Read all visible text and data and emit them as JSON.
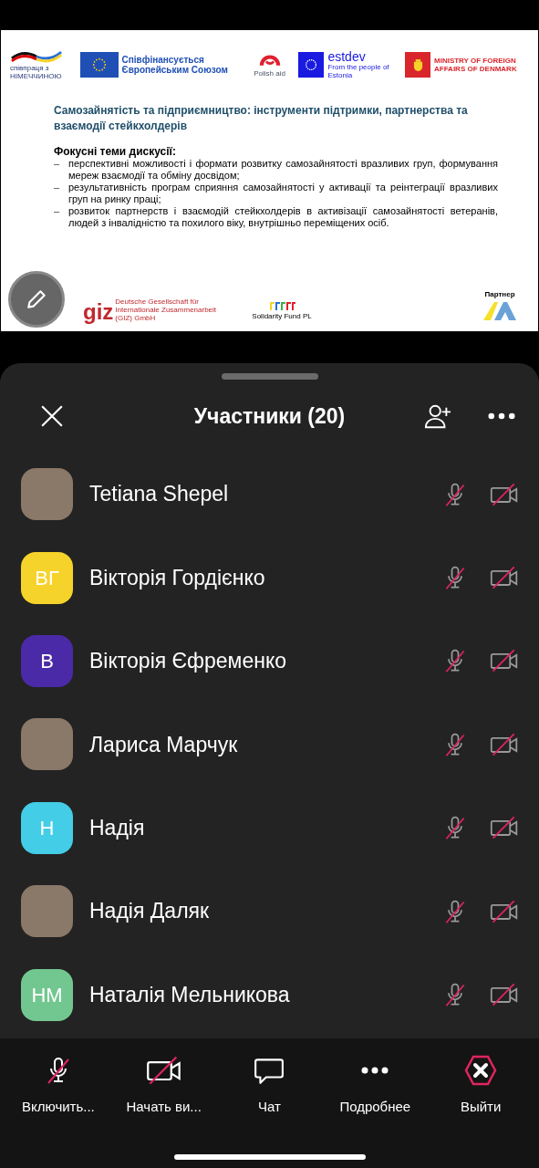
{
  "slide": {
    "logos": {
      "germany": "співпраця з НІМЕЧЧИНОЮ",
      "eu": "Співфінансується Європейським Союзом",
      "polish": "Polish aid",
      "estdev": "estdev",
      "estdev_sub": "From the people of Estonia",
      "denmark": "MINISTRY OF FOREIGN AFFAIRS OF DENMARK"
    },
    "title": "Самозайнятість та підприємництво: інструменти підтримки, партнерства та взаємодії стейкхолдерів",
    "focus_heading": "Фокусні теми дискусії:",
    "bullets": [
      {
        "marker": "–",
        "text": "перспективні можливості і формати розвитку самозайнятості вразливих груп, формування мереж взаємодії та обміну досвідом;"
      },
      {
        "marker": "–",
        "text": "результативність програм сприяння самозайнятості у активації та реінтеграції вразливих груп на ринку праці;"
      },
      {
        "marker": "–",
        "text": "розвиток партнерств і взаємодій стейкхолдерів в активізації самозайнятості ветеранів, людей з інвалідністю та похилого віку, внутрішньо переміщених осіб."
      }
    ],
    "footer": {
      "giz": "giz",
      "giz_sub": "Deutsche Gesellschaft für Internationale Zusammenarbeit (GIZ) GmbH",
      "solidarity": "Solidarity Fund PL",
      "partner_label": "Партнер"
    }
  },
  "panel": {
    "title": "Участники (20)",
    "participants": [
      {
        "name": "Tetiana Shepel",
        "kind": "photo",
        "mic_muted": true,
        "video_off": true
      },
      {
        "name": "Вікторія Гордієнко",
        "kind": "initials",
        "initials": "ВГ",
        "color": "#f6d32a",
        "mic_muted": true,
        "video_off": true
      },
      {
        "name": "Вікторія Єфременко",
        "kind": "initials",
        "initials": "В",
        "color": "#4b2aa8",
        "mic_muted": true,
        "video_off": true
      },
      {
        "name": "Лариса Марчук",
        "kind": "photo",
        "mic_muted": true,
        "video_off": true
      },
      {
        "name": "Надія",
        "kind": "initials",
        "initials": "Н",
        "color": "#43cde6",
        "mic_muted": true,
        "video_off": true
      },
      {
        "name": "Надія Даляк",
        "kind": "photo",
        "mic_muted": true,
        "video_off": true
      },
      {
        "name": "Наталія Мельникова",
        "kind": "initials",
        "initials": "НМ",
        "color": "#72c790",
        "mic_muted": true,
        "video_off": true
      }
    ]
  },
  "toolbar": [
    {
      "kind": "mic",
      "label": "Включить..."
    },
    {
      "kind": "video",
      "label": "Начать ви..."
    },
    {
      "kind": "chat",
      "label": "Чат"
    },
    {
      "kind": "more",
      "label": "Подробнее"
    },
    {
      "kind": "leave",
      "label": "Выйти"
    }
  ]
}
